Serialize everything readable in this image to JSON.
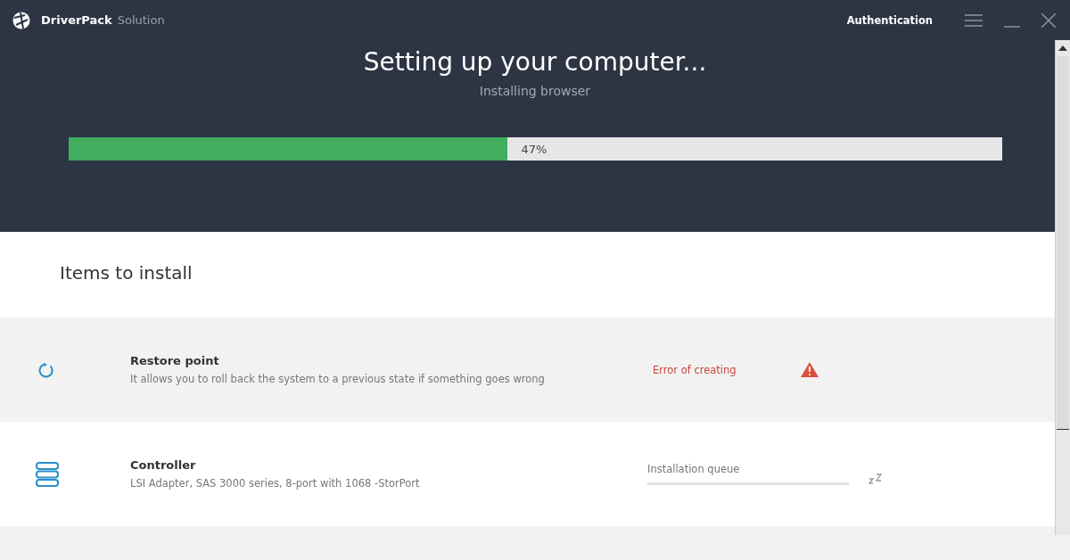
{
  "window": {
    "app_name_bold": "DriverPack",
    "app_name_light": "Solution",
    "auth_link": "Authentication"
  },
  "header": {
    "title": "Setting up your computer...",
    "subtitle": "Installing browser"
  },
  "progress": {
    "level": 0.47,
    "label": "47%"
  },
  "section_title": "Items to install",
  "items": [
    {
      "kind": "spinner",
      "name": "Restore point",
      "description": "It allows you to roll back the system to a previous state if something goes wrong",
      "status": {
        "kind": "error",
        "text": "Error of creating"
      }
    },
    {
      "kind": "server",
      "name": "Controller",
      "description": "LSI Adapter, SAS 3000 series, 8-port with 1068 -StorPort",
      "status": {
        "kind": "queue",
        "text": "Installation queue",
        "level": 0
      }
    },
    {
      "kind": "blank"
    }
  ]
}
